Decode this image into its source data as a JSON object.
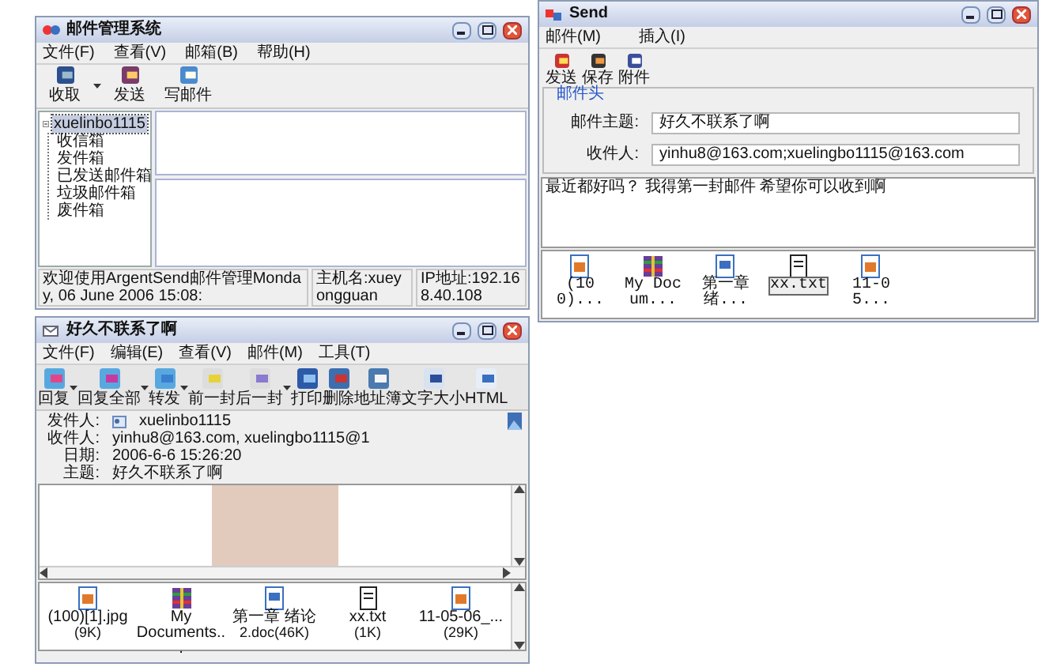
{
  "main_window": {
    "title": "邮件管理系统",
    "menu": [
      "文件(F)",
      "查看(V)",
      "邮箱(B)",
      "帮助(H)"
    ],
    "toolbar": [
      {
        "label": "收取",
        "dropdown": true
      },
      {
        "label": "发送",
        "dropdown": false
      },
      {
        "label": "写邮件",
        "dropdown": false
      }
    ],
    "tree": [
      {
        "label": "xuelinbo1115",
        "expanded": true,
        "selected": true,
        "children": [
          {
            "label": "收信箱",
            "selected": false
          },
          {
            "label": "发件箱",
            "selected": false
          },
          {
            "label": "已发送邮件箱",
            "selected": false
          },
          {
            "label": "垃圾邮件箱",
            "selected": false
          },
          {
            "label": "废件箱",
            "selected": false
          }
        ]
      }
    ],
    "status_bar": [
      "欢迎使用ArgentSend邮件管理Monday, 06 June 2006 15:08:",
      "主机名:xueyongguan",
      "IP地址:192.168.40.108"
    ]
  },
  "send_window": {
    "title": "Send",
    "menu": [
      "邮件(M)",
      "插入(I)"
    ],
    "toolbar": [
      "发送",
      "保存",
      "附件"
    ],
    "group_title": "邮件头",
    "fields": [
      {
        "label": "邮件主题:",
        "value": "好久不联系了啊"
      },
      {
        "label": "收件人:",
        "value": "yinhu8@163.com;xuelingbo1115@163.com"
      }
    ],
    "body": "最近都好吗？ 我得第一封邮件 希望你可以收到啊",
    "attachments": [
      {
        "kind": "image",
        "name": "(100)...",
        "selected": false
      },
      {
        "kind": "archive",
        "name": "My Docum...",
        "selected": false
      },
      {
        "kind": "document",
        "name": "第一章绪...",
        "selected": false
      },
      {
        "kind": "text",
        "name": "xx.txt",
        "selected": true
      },
      {
        "kind": "image",
        "name": "11-05...",
        "selected": false
      }
    ]
  },
  "message_window": {
    "title": "好久不联系了啊",
    "menu": [
      "文件(F)",
      "编辑(E)",
      "查看(V)",
      "邮件(M)",
      "工具(T)"
    ],
    "toolbar": [
      {
        "kind": "reply",
        "label": "回复",
        "dropdown": true
      },
      {
        "kind": "reply_all",
        "label": "回复全部",
        "dropdown": true
      },
      {
        "kind": "forward",
        "label": "转发",
        "dropdown": true
      },
      {
        "kind": "previous",
        "label": "前一封",
        "dropdown": false
      },
      {
        "kind": "next",
        "label": "后一封",
        "dropdown": true
      },
      {
        "kind": "print",
        "label": "打印",
        "dropdown": false
      },
      {
        "kind": "delete",
        "label": "删除",
        "dropdown": false
      },
      {
        "kind": "addresses",
        "label": "地址簿",
        "dropdown": false
      },
      {
        "kind": "font",
        "label": "文字大小",
        "dropdown": false
      },
      {
        "kind": "html",
        "label": "HTML",
        "dropdown": false
      }
    ],
    "header": [
      {
        "label": "发件人:",
        "value": "xuelinbo1115",
        "contact": true
      },
      {
        "label": "收件人:",
        "value": "yinhu8@163.com, xuelingbo1115@1",
        "contact": false
      },
      {
        "label": "日期:",
        "value": "2006-6-6 15:26:20",
        "contact": false
      },
      {
        "label": "主题:",
        "value": "好久不联系了啊",
        "contact": false
      }
    ],
    "attachments": [
      {
        "kind": "image",
        "name": "(100)[1].jpg",
        "size": "(9K)"
      },
      {
        "kind": "archive",
        "name": "My Documents..."
      },
      {
        "kind": "document",
        "name": "第一章 绪论",
        "size": "2.doc(46K)"
      },
      {
        "kind": "text",
        "name": "xx.txt",
        "size": "(1K)"
      },
      {
        "kind": "image",
        "name": "11-05-06_...",
        "size": "(29K)"
      }
    ]
  }
}
